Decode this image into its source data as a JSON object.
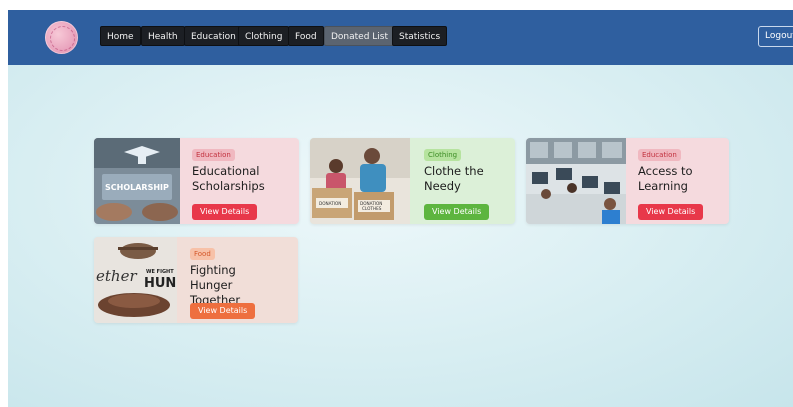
{
  "nav": {
    "items": [
      {
        "label": "Home"
      },
      {
        "label": "Health"
      },
      {
        "label": "Education"
      },
      {
        "label": "Clothing"
      },
      {
        "label": "Food"
      },
      {
        "label": "Donated List",
        "active": true
      },
      {
        "label": "Statistics"
      }
    ],
    "logout_label": "Logout"
  },
  "cards": [
    {
      "category": "Education",
      "title": "Educational Scholarships",
      "button": "View Details",
      "image_icon": "scholarship-photo"
    },
    {
      "category": "Clothing",
      "title": "Clothe the Needy",
      "button": "View Details",
      "image_icon": "donation-boxes-photo"
    },
    {
      "category": "Education",
      "title": "Access to Learning",
      "button": "View Details",
      "image_icon": "classroom-photo"
    },
    {
      "category": "Food",
      "title": "Fighting Hunger Together",
      "button": "View Details",
      "image_icon": "hands-bowl-photo"
    }
  ],
  "colors": {
    "navbar": "#2f5f9f",
    "education_card": "#f5dade",
    "clothing_card": "#dcf0d8",
    "food_card": "#f1ded8",
    "education_button": "#e8384a",
    "clothing_button": "#5db53f",
    "food_button": "#ee6f3f"
  }
}
